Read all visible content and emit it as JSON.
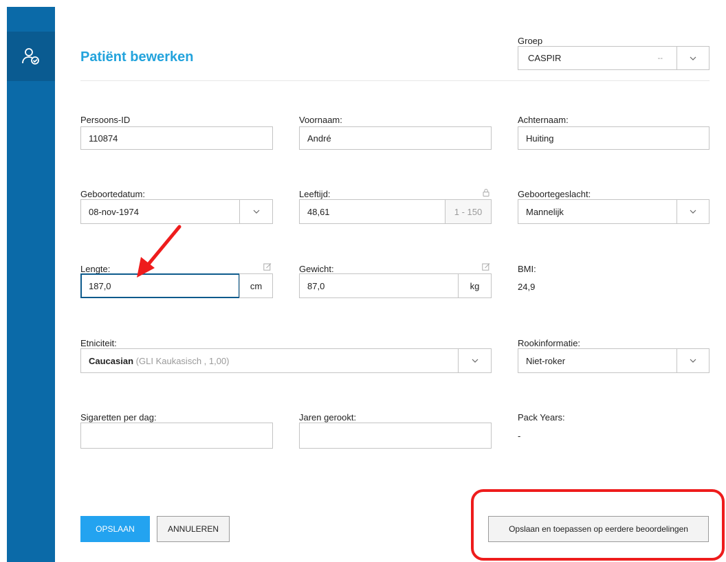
{
  "title": "Patiënt bewerken",
  "groep": {
    "label": "Groep",
    "value": "CASPIR",
    "secondary": "--"
  },
  "fields": {
    "persoons_id": {
      "label": "Persoons-ID",
      "value": "110874"
    },
    "voornaam": {
      "label": "Voornaam:",
      "value": "André"
    },
    "achternaam": {
      "label": "Achternaam:",
      "value": "Huiting"
    },
    "geboortedatum": {
      "label": "Geboortedatum:",
      "value": "08-nov-1974"
    },
    "leeftijd": {
      "label": "Leeftijd:",
      "value": "48,61",
      "range": "1 - 150"
    },
    "geboortegeslacht": {
      "label": "Geboortegeslacht:",
      "value": "Mannelijk"
    },
    "lengte": {
      "label": "Lengte:",
      "value": "187,0",
      "unit": "cm"
    },
    "gewicht": {
      "label": "Gewicht:",
      "value": "87,0",
      "unit": "kg"
    },
    "bmi": {
      "label": "BMI:",
      "value": "24,9"
    },
    "etniciteit": {
      "label": "Etniciteit:",
      "value": "Caucasian",
      "detail": "(GLI Kaukasisch ,  1,00)"
    },
    "rookinformatie": {
      "label": "Rookinformatie:",
      "value": "Niet-roker"
    },
    "sigaretten": {
      "label": "Sigaretten per dag:",
      "value": ""
    },
    "jaren_gerookt": {
      "label": "Jaren gerookt:",
      "value": ""
    },
    "pack_years": {
      "label": "Pack Years:",
      "value": "-"
    }
  },
  "buttons": {
    "save": "OPSLAAN",
    "cancel": "ANNULEREN",
    "save_apply": "Opslaan en toepassen op eerdere beoordelingen"
  },
  "icons": {
    "sidebar": "user-check-icon",
    "lock": "lock-icon",
    "edit": "edit-icon",
    "dropdown": "chevron-down-icon"
  },
  "colors": {
    "sidebar": "#0b6aa8",
    "title": "#23a3dc",
    "primary_button": "#23a3f0",
    "annotation": "#ee1c1c"
  }
}
